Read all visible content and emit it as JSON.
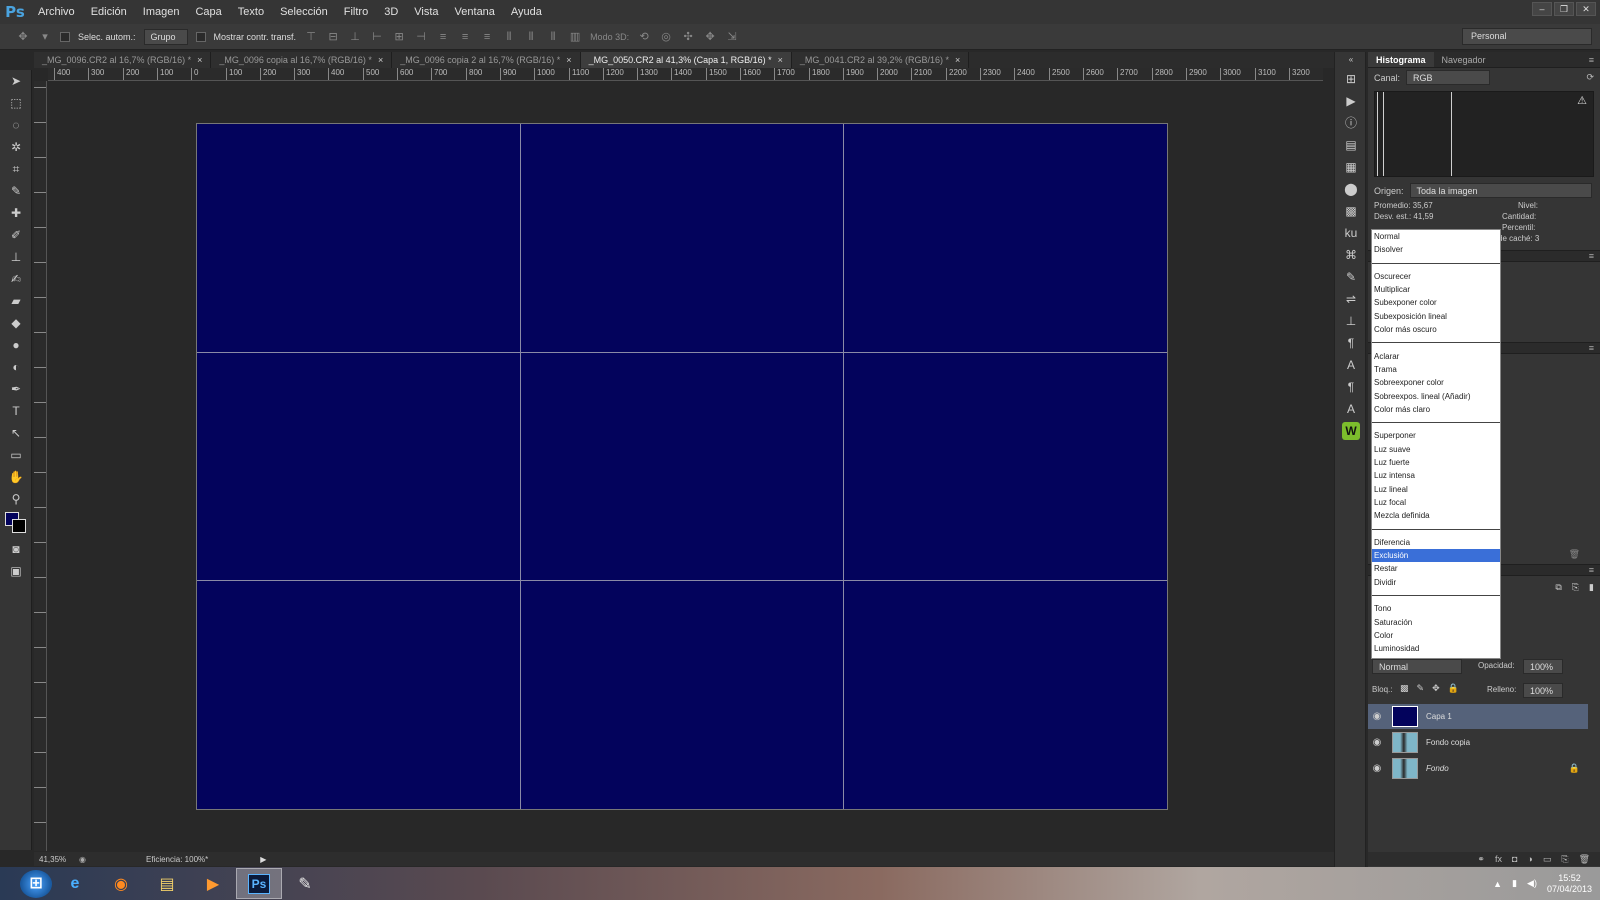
{
  "app": {
    "logo": "Ps"
  },
  "menu": [
    "Archivo",
    "Edición",
    "Imagen",
    "Capa",
    "Texto",
    "Selección",
    "Filtro",
    "3D",
    "Vista",
    "Ventana",
    "Ayuda"
  ],
  "window_controls": [
    "–",
    "❐",
    "✕"
  ],
  "options": {
    "auto_select_label": "Selec. autom.:",
    "auto_select_value": "Grupo",
    "transform_label": "Mostrar contr. transf.",
    "mode3d_label": "Modo 3D:",
    "workspace": "Personal"
  },
  "tabs": [
    {
      "label": "_MG_0096.CR2 al 16,7% (RGB/16) *",
      "active": false
    },
    {
      "label": "_MG_0096 copia al 16,7% (RGB/16) *",
      "active": false
    },
    {
      "label": "_MG_0096 copia 2 al 16,7% (RGB/16) *",
      "active": false
    },
    {
      "label": "_MG_0050.CR2 al 41,3% (Capa 1, RGB/16) *",
      "active": true
    },
    {
      "label": "_MG_0041.CR2 al 39,2% (RGB/16) *",
      "active": false
    }
  ],
  "tab_close": "×",
  "ruler_h": [
    "400",
    "300",
    "200",
    "100",
    "0",
    "100",
    "200",
    "300",
    "400",
    "500",
    "600",
    "700",
    "800",
    "900",
    "1000",
    "1100",
    "1200",
    "1300",
    "1400",
    "1500",
    "1600",
    "1700",
    "1800",
    "1900",
    "2000",
    "2100",
    "2200",
    "2300",
    "2400",
    "2500",
    "2600",
    "2700",
    "2800",
    "2900",
    "3000",
    "3100",
    "3200"
  ],
  "status": {
    "zoom": "41,35%",
    "efficiency": "Eficiencia: 100%*"
  },
  "histogram": {
    "tabs": [
      "Histograma",
      "Navegador"
    ],
    "channel_label": "Canal:",
    "channel_value": "RGB",
    "source_label": "Origen:",
    "source_value": "Toda la imagen",
    "stats": {
      "mean": "Promedio:  35,67",
      "stddev": "Desv. est.:  41,59",
      "level": "Nivel:",
      "count": "Cantidad:",
      "percentile": "Percentil:",
      "cache": "Nivel de caché:  3"
    }
  },
  "blend_modes": [
    [
      "Normal",
      "Disolver"
    ],
    [
      "Oscurecer",
      "Multiplicar",
      "Subexponer color",
      "Subexposición lineal",
      "Color más oscuro"
    ],
    [
      "Aclarar",
      "Trama",
      "Sobreexponer color",
      "Sobreexpos. lineal (Añadir)",
      "Color más claro"
    ],
    [
      "Superponer",
      "Luz suave",
      "Luz fuerte",
      "Luz intensa",
      "Luz lineal",
      "Luz focal",
      "Mezcla definida"
    ],
    [
      "Diferencia",
      "Exclusión",
      "Restar",
      "Dividir"
    ],
    [
      "Tono",
      "Saturación",
      "Color",
      "Luminosidad"
    ]
  ],
  "blend_selected": "Exclusión",
  "layers": {
    "blend_value": "Normal",
    "opacity_label": "Opacidad:",
    "opacity_value": "100%",
    "lock_label": "Bloq.:",
    "fill_label": "Relleno:",
    "fill_value": "100%",
    "items": [
      {
        "name": "Capa 1",
        "active": true
      },
      {
        "name": "Fondo copia",
        "active": false
      },
      {
        "name": "Fondo",
        "active": false
      }
    ]
  },
  "taskbar": {
    "time": "15:52",
    "date": "07/04/2013"
  },
  "colors": {
    "canvas": "#03035c",
    "foreground": "#03035c",
    "background": "#000000",
    "selection": "#3a6fd8",
    "layer_active": "#55627a"
  }
}
